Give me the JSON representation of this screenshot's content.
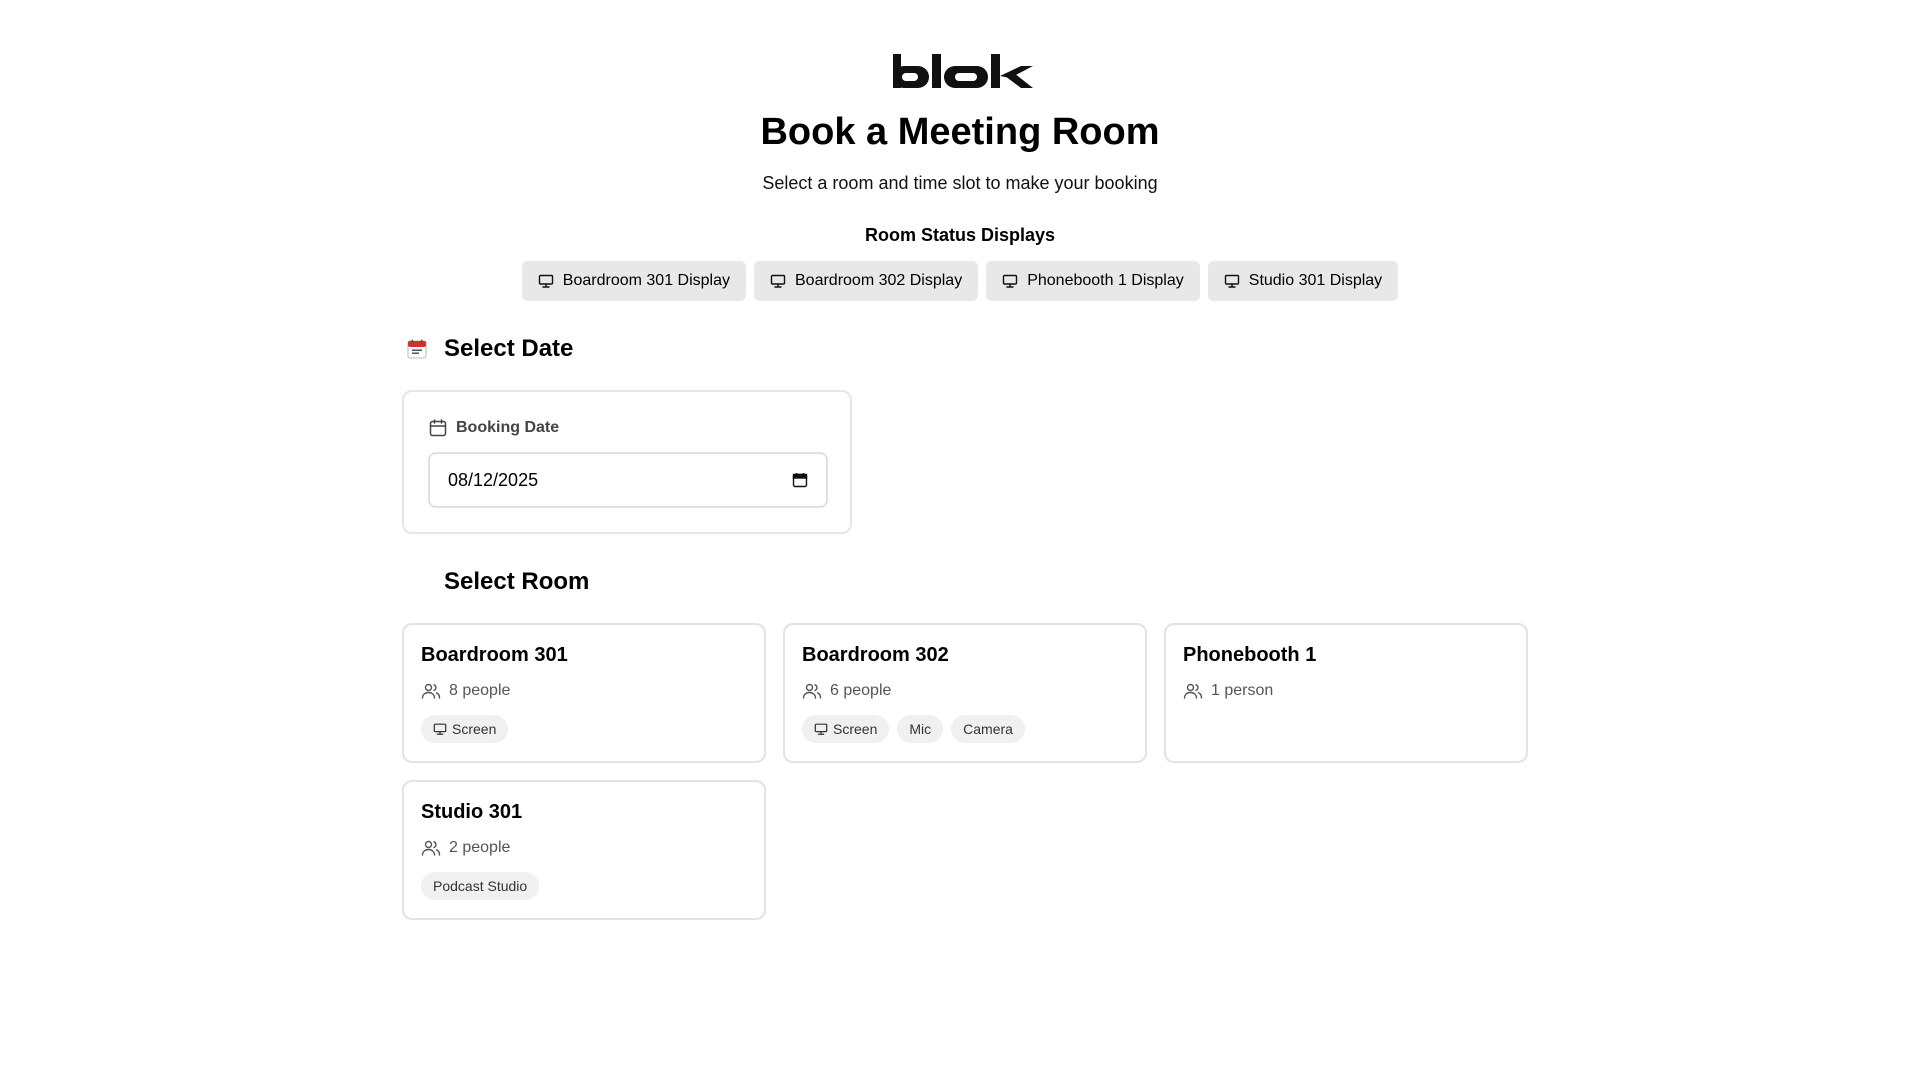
{
  "header": {
    "logo_text": "blok",
    "title": "Book a Meeting Room",
    "subtitle": "Select a room and time slot to make your booking"
  },
  "displays": {
    "heading": "Room Status Displays",
    "buttons": [
      {
        "label": "Boardroom 301 Display",
        "icon": "monitor-icon"
      },
      {
        "label": "Boardroom 302 Display",
        "icon": "monitor-icon"
      },
      {
        "label": "Phonebooth 1 Display",
        "icon": "monitor-icon"
      },
      {
        "label": "Studio 301 Display",
        "icon": "monitor-icon"
      }
    ]
  },
  "date_section": {
    "heading": "Select Date",
    "heading_icon": "calendar-emoji-icon",
    "label": "Booking Date",
    "value": "08/12/2025"
  },
  "room_section": {
    "heading": "Select Room",
    "rooms": [
      {
        "name": "Boardroom 301",
        "capacity": "8 people",
        "features": [
          "Screen"
        ]
      },
      {
        "name": "Boardroom 302",
        "capacity": "6 people",
        "features": [
          "Screen",
          "Mic",
          "Camera"
        ]
      },
      {
        "name": "Phonebooth 1",
        "capacity": "1 person",
        "features": []
      },
      {
        "name": "Studio 301",
        "capacity": "2 people",
        "features": [
          "Podcast Studio"
        ]
      }
    ]
  },
  "colors": {
    "button_bg": "#e8e8e8",
    "card_border": "#e3e3e3",
    "chip_bg": "#f0f0f0",
    "text_muted": "#555555",
    "calendar_red": "#d93025"
  }
}
